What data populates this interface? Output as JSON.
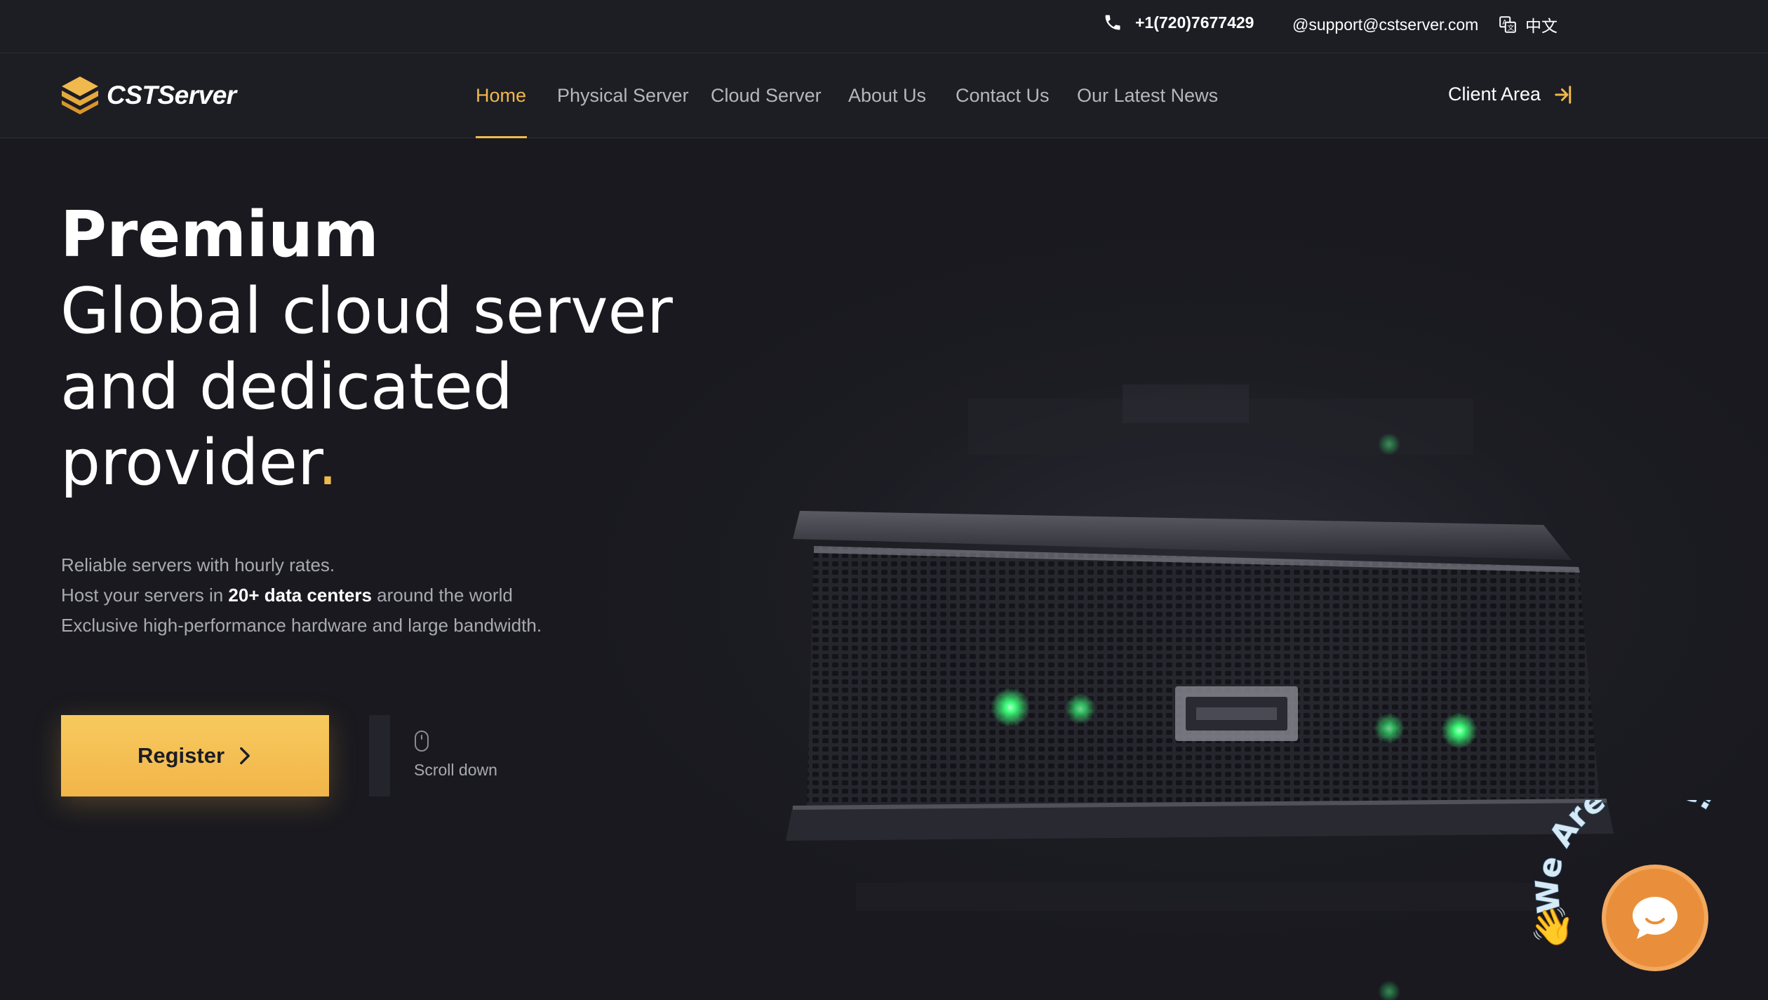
{
  "topbar": {
    "phone": "+1(720)7677429",
    "email": "@support@cstserver.com",
    "language": "中文",
    "icons": {
      "phone": "phone-icon",
      "translate": "translate-icon"
    }
  },
  "brand": {
    "name": "CSTServer",
    "accent": "#f0b94d"
  },
  "nav": {
    "items": [
      {
        "label": "Home",
        "active": true
      },
      {
        "label": "Physical Server",
        "active": false
      },
      {
        "label": "Cloud Server",
        "active": false
      },
      {
        "label": "About Us",
        "active": false
      },
      {
        "label": "Contact Us",
        "active": false
      },
      {
        "label": "Our Latest News",
        "active": false
      }
    ],
    "client_area": "Client Area"
  },
  "hero": {
    "premium": "Premium",
    "line1": "Global cloud server",
    "line2": "and dedicated",
    "line3": "provider",
    "dot": ".",
    "desc1": "Reliable servers with hourly rates.",
    "desc2_pre": "Host your servers in ",
    "desc2_bold": "20+ data centers",
    "desc2_post": " around the world",
    "desc3": "Exclusive high-performance hardware and large bandwidth."
  },
  "actions": {
    "register": "Register",
    "scroll_down": "Scroll down"
  },
  "chat": {
    "tagline": "We Are Here!",
    "hand": "👋"
  },
  "colors": {
    "background": "#1b1b22",
    "accent": "#f0b94d",
    "chat_orange": "#e98f3b",
    "led_green": "#3dff7a"
  }
}
